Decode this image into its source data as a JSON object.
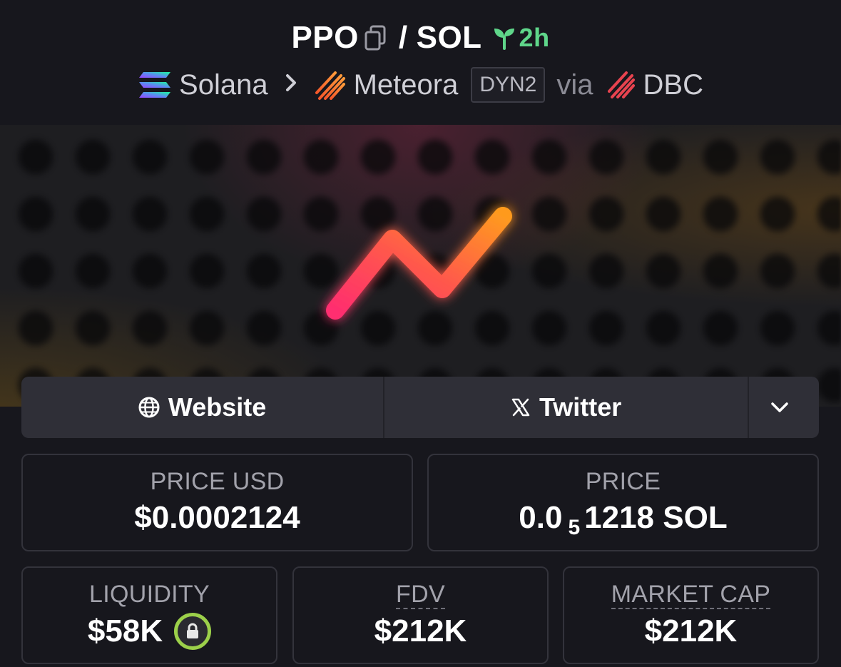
{
  "header": {
    "token_symbol": "PPO",
    "separator": "/",
    "quote_symbol": "SOL",
    "age": "2h",
    "chain": "Solana",
    "dex": "Meteora",
    "pool_type": "DYN2",
    "via_label": "via",
    "launchpad": "DBC"
  },
  "links": {
    "website_label": "Website",
    "twitter_label": "Twitter"
  },
  "stats": {
    "price_usd": {
      "label": "PRICE USD",
      "value": "$0.0002124"
    },
    "price": {
      "label": "PRICE",
      "value_prefix": "0.0",
      "zero_count": "5",
      "value_suffix": "1218 SOL"
    },
    "liquidity": {
      "label": "LIQUIDITY",
      "value": "$58K"
    },
    "fdv": {
      "label": "FDV",
      "value": "$212K"
    },
    "market_cap": {
      "label": "MARKET CAP",
      "value": "$212K"
    }
  },
  "icons": {
    "copy": "copy-icon",
    "age": "seedling-icon",
    "chain": "solana-icon",
    "dex": "meteora-icon",
    "launchpad": "dbc-icon",
    "website": "globe-icon",
    "twitter": "x-icon",
    "more": "chevron-down-icon",
    "liquidity_lock": "lock-icon"
  },
  "colors": {
    "background": "#17171d",
    "age_green": "#5fd68a",
    "lock_green": "#9cd04a",
    "logo_gradient_start": "#ff2d6f",
    "logo_gradient_end": "#ff9a1f"
  }
}
